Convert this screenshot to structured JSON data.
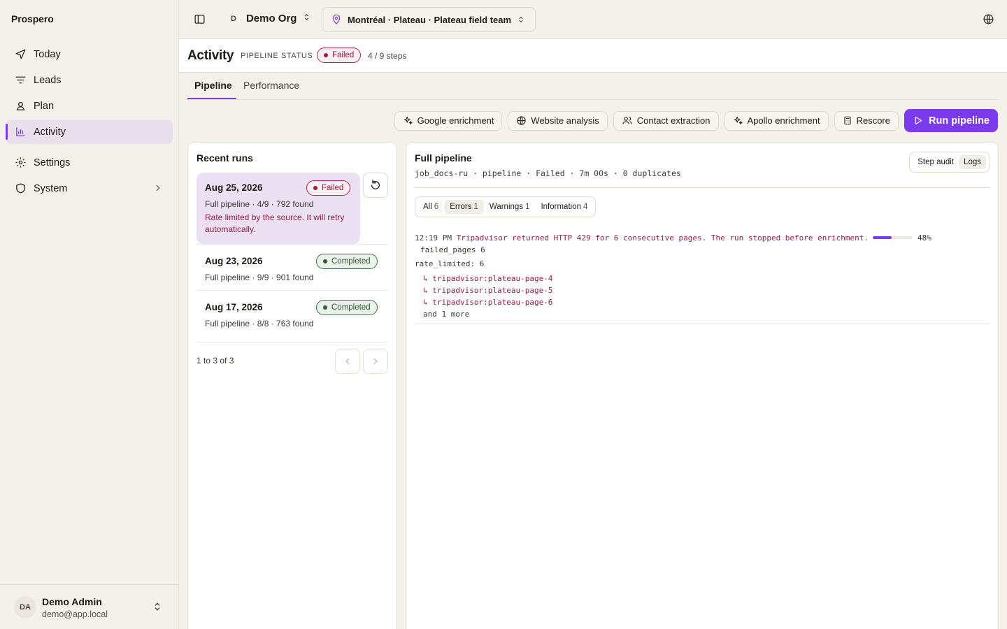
{
  "app": {
    "brand": "Prospero"
  },
  "sidebar": {
    "items": [
      {
        "label": "Today",
        "icon": "navigation-arrow-icon"
      },
      {
        "label": "Leads",
        "icon": "filter-lines-icon"
      },
      {
        "label": "Plan",
        "icon": "user-pin-icon"
      },
      {
        "label": "Activity",
        "icon": "bar-chart-icon",
        "active": true
      },
      {
        "label": "Settings",
        "icon": "gear-icon"
      },
      {
        "label": "System",
        "icon": "shield-icon"
      }
    ],
    "user": {
      "initials": "DA",
      "name": "Demo Admin",
      "email": "demo@app.local"
    }
  },
  "topbar": {
    "org_initial": "D",
    "org_name": "Demo Org",
    "location": "Montréal · Plateau · Plateau field team"
  },
  "page": {
    "title": "Activity",
    "pipeline_status_label": "PIPELINE STATUS",
    "status": "Failed",
    "steps": "4 / 9 steps",
    "tabs": [
      "Pipeline",
      "Performance"
    ]
  },
  "toolbar": {
    "buttons": [
      "Google enrichment",
      "Website analysis",
      "Contact extraction",
      "Apollo enrichment",
      "Rescore"
    ],
    "run_label": "Run pipeline"
  },
  "runs": {
    "title": "Recent runs",
    "items": [
      {
        "date": "Aug 25, 2026",
        "status": "Failed",
        "meta": "Full pipeline · 4/9 · 792 found",
        "error": "Rate limited by the source. It will retry automatically."
      },
      {
        "date": "Aug 23, 2026",
        "status": "Completed",
        "meta": "Full pipeline · 9/9 · 901 found"
      },
      {
        "date": "Aug 17, 2026",
        "status": "Completed",
        "meta": "Full pipeline · 8/8 · 763 found"
      }
    ],
    "pager": "1 to 3 of 3"
  },
  "detail": {
    "title": "Full pipeline",
    "subtitle": "job_docs-ru · pipeline · Failed · 7m 00s · 0 duplicates",
    "views": [
      "Step audit",
      "Logs"
    ],
    "filters": [
      {
        "label": "All",
        "count": "6"
      },
      {
        "label": "Errors",
        "count": "1"
      },
      {
        "label": "Warnings",
        "count": "1"
      },
      {
        "label": "Information",
        "count": "4"
      }
    ],
    "log": {
      "time": "12:19 PM",
      "message": "Tripadvisor returned HTTP 429 for 6 consecutive pages. The run stopped before enrichment.",
      "progress_percent": 48,
      "progress_label": "48%",
      "failed_pages": "failed_pages 6",
      "rate_limited": "rate_limited: 6",
      "pages": [
        "↳ tripadvisor:plateau-page-4",
        "↳ tripadvisor:plateau-page-5",
        "↳ tripadvisor:plateau-page-6"
      ],
      "more": "and 1 more"
    }
  },
  "colors": {
    "accent": "#7c3aed",
    "error": "#9b1c43",
    "success": "#2f5a3a"
  }
}
